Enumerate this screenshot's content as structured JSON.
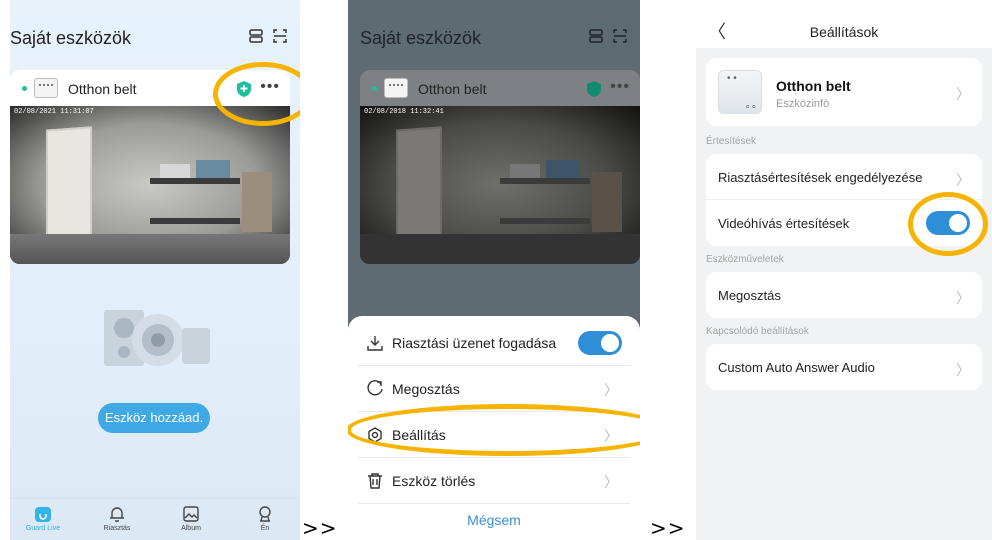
{
  "separators": [
    ">>",
    ">>"
  ],
  "screen1": {
    "title": "Saját eszközök",
    "device_name": "Otthon belt",
    "timestamp": "02/08/2021 11:31:07",
    "add_device_label": "Eszköz hozzáad.",
    "tabs": [
      {
        "label": "Guard Live",
        "icon": "home-icon"
      },
      {
        "label": "Riasztás",
        "icon": "bell-icon"
      },
      {
        "label": "Album",
        "icon": "image-icon"
      },
      {
        "label": "Én",
        "icon": "user-icon"
      }
    ]
  },
  "screen2": {
    "title": "Saját eszközök",
    "device_name": "Otthon belt",
    "timestamp": "02/08/2018 11:32:41",
    "sheet": {
      "alarm_receive_label": "Riasztási üzenet fogadása",
      "alarm_receive_on": true,
      "share_label": "Megosztás",
      "settings_label": "Beállítás",
      "delete_label": "Eszköz törlés",
      "cancel_label": "Mégsem"
    }
  },
  "screen3": {
    "title": "Beállítások",
    "device_title": "Otthon belt",
    "device_subtitle": "Eszközinfó",
    "section_notifications": "Értesítések",
    "enable_alarm_notifications": "Riasztásértesítések engedélyezése",
    "video_call_notifications": "Videóhívás értesítések",
    "video_call_on": true,
    "section_device_ops": "Eszközműveletek",
    "share": "Megosztás",
    "section_related": "Kapcsolódó beállítások",
    "custom_audio": "Custom Auto Answer Audio"
  },
  "colors": {
    "highlight": "#f6b400",
    "toggle_on": "#2f8fd6",
    "accent": "#3fa9e6"
  }
}
